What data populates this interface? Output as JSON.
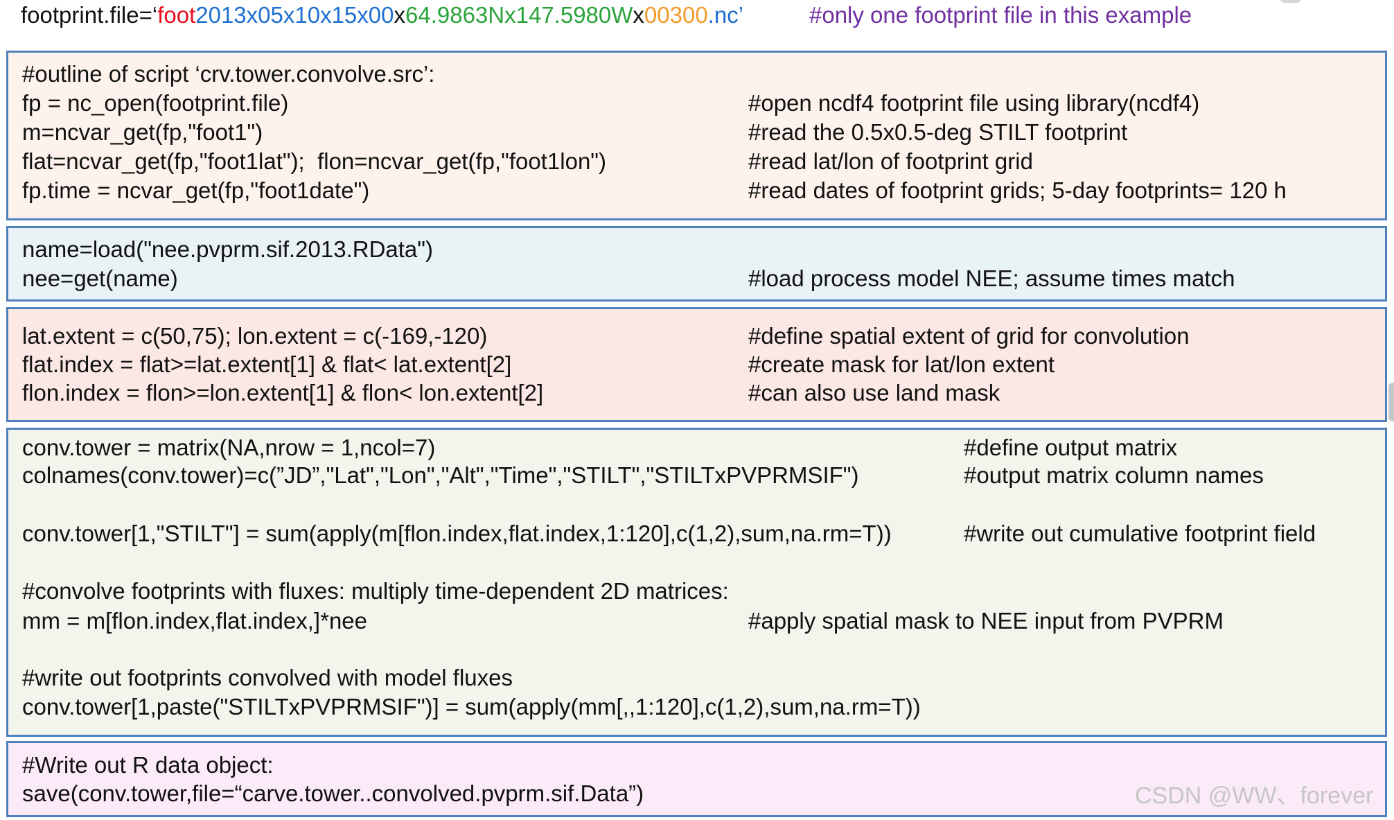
{
  "header": {
    "prefix": "footprint.file=‘",
    "foot": "foot",
    "date": "2013x05x10x15x00",
    "x1": "x",
    "coords": "64.9863Nx147.5980W",
    "x2": "x",
    "alt": "00300",
    "suffix": ".nc’",
    "comment": "#only one footprint file in this example"
  },
  "blocks": [
    {
      "lines": [
        {
          "code": "#outline of script ‘crv.tower.convolve.src’:",
          "comment": ""
        },
        {
          "code": "fp = nc_open(footprint.file)",
          "comment": "#open ncdf4 footprint file using library(ncdf4)"
        },
        {
          "code": "m=ncvar_get(fp,\"foot1\")",
          "comment": "#read the 0.5x0.5-deg STILT footprint"
        },
        {
          "code": "flat=ncvar_get(fp,\"foot1lat\");  flon=ncvar_get(fp,\"foot1lon\")",
          "comment": "#read lat/lon of footprint grid"
        },
        {
          "code": "fp.time = ncvar_get(fp,\"foot1date\")",
          "comment": "#read dates of footprint grids; 5-day footprints= 120 h"
        }
      ]
    },
    {
      "lines": [
        {
          "code": "name=load(\"nee.pvprm.sif.2013.RData\")",
          "comment": ""
        },
        {
          "code": "nee=get(name)",
          "comment": "#load process model NEE; assume times match"
        }
      ]
    },
    {
      "lines": [
        {
          "code": "lat.extent = c(50,75); lon.extent = c(-169,-120)",
          "comment": "#define spatial extent of grid for convolution"
        },
        {
          "code": "flat.index = flat>=lat.extent[1] & flat< lat.extent[2]",
          "comment": "#create mask for lat/lon extent"
        },
        {
          "code": "flon.index = flon>=lon.extent[1] & flon< lon.extent[2]",
          "comment": "#can also use land mask"
        }
      ]
    },
    {
      "lines": [
        {
          "code": "conv.tower = matrix(NA,nrow = 1,ncol=7)",
          "comment": "#define output matrix"
        },
        {
          "code": "colnames(conv.tower)=c(”JD”,\"Lat\",\"Lon\",\"Alt\",\"Time\",\"STILT\",\"STILTxPVPRMSIF\")",
          "comment": "#output matrix column names"
        },
        {
          "code": "conv.tower[1,\"STILT\"] = sum(apply(m[flon.index,flat.index,1:120],c(1,2),sum,na.rm=T))",
          "comment": "#write out cumulative footprint field"
        },
        {
          "code": "#convolve footprints with fluxes: multiply time-dependent 2D matrices:",
          "comment": ""
        },
        {
          "code": "mm = m[flon.index,flat.index,]*nee",
          "comment": "#apply spatial mask to NEE input from PVPRM"
        },
        {
          "code": "#write out footprints convolved with model fluxes",
          "comment": ""
        },
        {
          "code": "conv.tower[1,paste(\"STILTxPVPRMSIF\")] = sum(apply(mm[,,1:120],c(1,2),sum,na.rm=T))",
          "comment": ""
        }
      ]
    },
    {
      "lines": [
        {
          "code": "#Write out R data object:",
          "comment": ""
        },
        {
          "code": "save(conv.tower,file=“carve.tower..convolved.pvprm.sif.Data”)",
          "comment": ""
        }
      ]
    }
  ],
  "watermark": "CSDN @WW、forever",
  "colors": {
    "border": "#4f81bd",
    "block1_bg": "#fdf3ec",
    "block2_bg": "#e9f3f6",
    "block3_bg": "#fbe7e3",
    "block4_bg": "#f1f5ec",
    "block5_bg": "#fbeaf7",
    "foot": "#e8101f",
    "date": "#1f6fd0",
    "coords": "#2aa33b",
    "alt": "#f39a2b",
    "comment": "#7030a0"
  }
}
